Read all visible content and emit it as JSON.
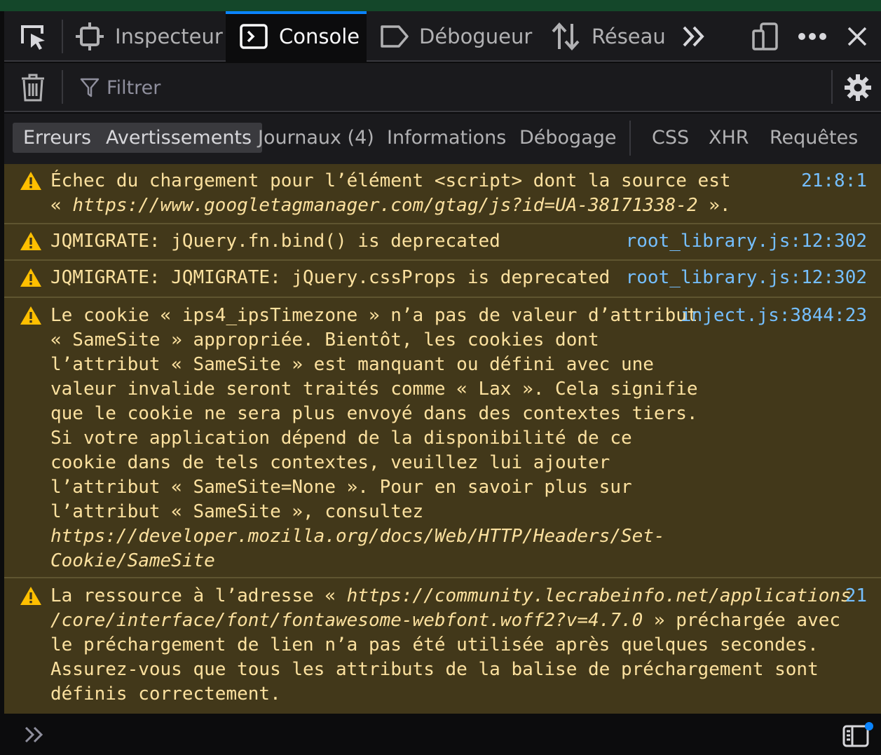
{
  "toolbar": {
    "tabs": {
      "inspector": "Inspecteur",
      "console": "Console",
      "debugger": "Débogueur",
      "network": "Réseau"
    },
    "icons": [
      "element-picker-icon",
      "inspector-icon",
      "console-icon",
      "debugger-icon",
      "network-icon",
      "overflow-chevrons-icon",
      "responsive-design-icon",
      "more-options-icon",
      "close-icon"
    ],
    "active_tab": "Console",
    "accent": "#0a84ff"
  },
  "filterbar": {
    "placeholder": "Filtrer"
  },
  "levels": {
    "errors": "Erreurs",
    "warnings": "Avertissements",
    "logs": "Journaux (4)",
    "info": "Informations",
    "debug": "Débogage",
    "css": "CSS",
    "xhr": "XHR",
    "requests": "Requêtes",
    "active": [
      "Erreurs",
      "Avertissements"
    ]
  },
  "messages": [
    {
      "level": "warning",
      "parts": [
        {
          "t": "Échec du chargement pour l’élément <script> dont la source est\n« "
        },
        {
          "t": "https://www.googletagmanager.com/gtag/js?id=UA-38171338-2",
          "i": true
        },
        {
          "t": " »."
        }
      ],
      "location": "21:8:1"
    },
    {
      "level": "warning",
      "parts": [
        {
          "t": "JQMIGRATE: jQuery.fn.bind() is deprecated"
        }
      ],
      "location": "root_library.js:12:302"
    },
    {
      "level": "warning",
      "parts": [
        {
          "t": "JQMIGRATE: JQMIGRATE: jQuery.cssProps is deprecated"
        }
      ],
      "location": "root_library.js:12:302"
    },
    {
      "level": "warning",
      "parts": [
        {
          "t": "Le cookie « ips4_ipsTimezone » n’a pas de valeur d’attribut\n« SameSite » appropriée. Bientôt, les cookies dont\nl’attribut « SameSite » est manquant ou défini avec une\nvaleur invalide seront traités comme « Lax ». Cela signifie\nque le cookie ne sera plus envoyé dans des contextes tiers.\nSi votre application dépend de la disponibilité de ce\ncookie dans de tels contextes, veuillez lui ajouter\nl’attribut « SameSite=None ». Pour en savoir plus sur\nl’attribut « SameSite », consultez\n"
        },
        {
          "t": "https://developer.mozilla.org/docs/Web/HTTP/Headers/Set-\nCookie/SameSite",
          "i": true
        }
      ],
      "location": "inject.js:3844:23"
    },
    {
      "level": "warning",
      "parts": [
        {
          "t": "La ressource à l’adresse « "
        },
        {
          "t": "https://community.lecrabeinfo.net/applications\n/core/interface/font/fontawesome-webfont.woff2?v=4.7.0",
          "i": true
        },
        {
          "t": " » préchargée avec\nle préchargement de lien n’a pas été utilisée après quelques secondes.\nAssurez-vous que tous les attributs de la balise de préchargement sont\ndéfinis correctement."
        }
      ],
      "location": "21"
    }
  ],
  "colors": {
    "warning_bg": "#42381a",
    "warning_text": "#fce19f",
    "location_link": "#75bfff",
    "warning_icon": "#ffbf00"
  }
}
